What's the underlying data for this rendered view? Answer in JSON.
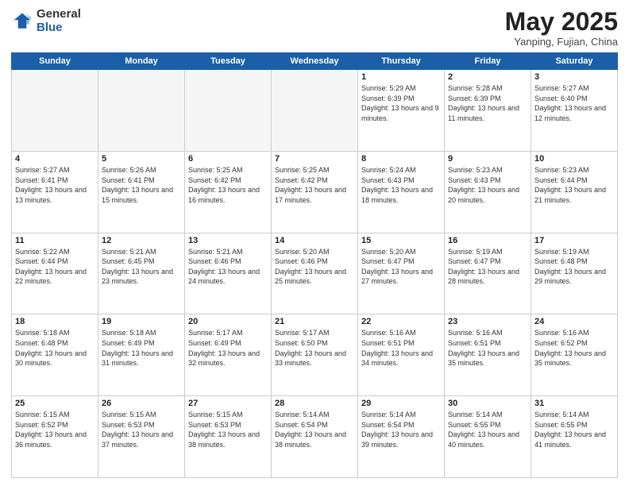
{
  "header": {
    "logo_general": "General",
    "logo_blue": "Blue",
    "title": "May 2025",
    "location": "Yanping, Fujian, China"
  },
  "days_of_week": [
    "Sunday",
    "Monday",
    "Tuesday",
    "Wednesday",
    "Thursday",
    "Friday",
    "Saturday"
  ],
  "weeks": [
    [
      {
        "day": "",
        "empty": true
      },
      {
        "day": "",
        "empty": true
      },
      {
        "day": "",
        "empty": true
      },
      {
        "day": "",
        "empty": true
      },
      {
        "day": "1",
        "sunrise": "5:29 AM",
        "sunset": "6:39 PM",
        "daylight": "13 hours and 9 minutes."
      },
      {
        "day": "2",
        "sunrise": "5:28 AM",
        "sunset": "6:39 PM",
        "daylight": "13 hours and 11 minutes."
      },
      {
        "day": "3",
        "sunrise": "5:27 AM",
        "sunset": "6:40 PM",
        "daylight": "13 hours and 12 minutes."
      }
    ],
    [
      {
        "day": "4",
        "sunrise": "5:27 AM",
        "sunset": "6:41 PM",
        "daylight": "13 hours and 13 minutes."
      },
      {
        "day": "5",
        "sunrise": "5:26 AM",
        "sunset": "6:41 PM",
        "daylight": "13 hours and 15 minutes."
      },
      {
        "day": "6",
        "sunrise": "5:25 AM",
        "sunset": "6:42 PM",
        "daylight": "13 hours and 16 minutes."
      },
      {
        "day": "7",
        "sunrise": "5:25 AM",
        "sunset": "6:42 PM",
        "daylight": "13 hours and 17 minutes."
      },
      {
        "day": "8",
        "sunrise": "5:24 AM",
        "sunset": "6:43 PM",
        "daylight": "13 hours and 18 minutes."
      },
      {
        "day": "9",
        "sunrise": "5:23 AM",
        "sunset": "6:43 PM",
        "daylight": "13 hours and 20 minutes."
      },
      {
        "day": "10",
        "sunrise": "5:23 AM",
        "sunset": "6:44 PM",
        "daylight": "13 hours and 21 minutes."
      }
    ],
    [
      {
        "day": "11",
        "sunrise": "5:22 AM",
        "sunset": "6:44 PM",
        "daylight": "13 hours and 22 minutes."
      },
      {
        "day": "12",
        "sunrise": "5:21 AM",
        "sunset": "6:45 PM",
        "daylight": "13 hours and 23 minutes."
      },
      {
        "day": "13",
        "sunrise": "5:21 AM",
        "sunset": "6:46 PM",
        "daylight": "13 hours and 24 minutes."
      },
      {
        "day": "14",
        "sunrise": "5:20 AM",
        "sunset": "6:46 PM",
        "daylight": "13 hours and 25 minutes."
      },
      {
        "day": "15",
        "sunrise": "5:20 AM",
        "sunset": "6:47 PM",
        "daylight": "13 hours and 27 minutes."
      },
      {
        "day": "16",
        "sunrise": "5:19 AM",
        "sunset": "6:47 PM",
        "daylight": "13 hours and 28 minutes."
      },
      {
        "day": "17",
        "sunrise": "5:19 AM",
        "sunset": "6:48 PM",
        "daylight": "13 hours and 29 minutes."
      }
    ],
    [
      {
        "day": "18",
        "sunrise": "5:18 AM",
        "sunset": "6:48 PM",
        "daylight": "13 hours and 30 minutes."
      },
      {
        "day": "19",
        "sunrise": "5:18 AM",
        "sunset": "6:49 PM",
        "daylight": "13 hours and 31 minutes."
      },
      {
        "day": "20",
        "sunrise": "5:17 AM",
        "sunset": "6:49 PM",
        "daylight": "13 hours and 32 minutes."
      },
      {
        "day": "21",
        "sunrise": "5:17 AM",
        "sunset": "6:50 PM",
        "daylight": "13 hours and 33 minutes."
      },
      {
        "day": "22",
        "sunrise": "5:16 AM",
        "sunset": "6:51 PM",
        "daylight": "13 hours and 34 minutes."
      },
      {
        "day": "23",
        "sunrise": "5:16 AM",
        "sunset": "6:51 PM",
        "daylight": "13 hours and 35 minutes."
      },
      {
        "day": "24",
        "sunrise": "5:16 AM",
        "sunset": "6:52 PM",
        "daylight": "13 hours and 35 minutes."
      }
    ],
    [
      {
        "day": "25",
        "sunrise": "5:15 AM",
        "sunset": "6:52 PM",
        "daylight": "13 hours and 36 minutes."
      },
      {
        "day": "26",
        "sunrise": "5:15 AM",
        "sunset": "6:53 PM",
        "daylight": "13 hours and 37 minutes."
      },
      {
        "day": "27",
        "sunrise": "5:15 AM",
        "sunset": "6:53 PM",
        "daylight": "13 hours and 38 minutes."
      },
      {
        "day": "28",
        "sunrise": "5:14 AM",
        "sunset": "6:54 PM",
        "daylight": "13 hours and 38 minutes."
      },
      {
        "day": "29",
        "sunrise": "5:14 AM",
        "sunset": "6:54 PM",
        "daylight": "13 hours and 39 minutes."
      },
      {
        "day": "30",
        "sunrise": "5:14 AM",
        "sunset": "6:55 PM",
        "daylight": "13 hours and 40 minutes."
      },
      {
        "day": "31",
        "sunrise": "5:14 AM",
        "sunset": "6:55 PM",
        "daylight": "13 hours and 41 minutes."
      }
    ]
  ]
}
